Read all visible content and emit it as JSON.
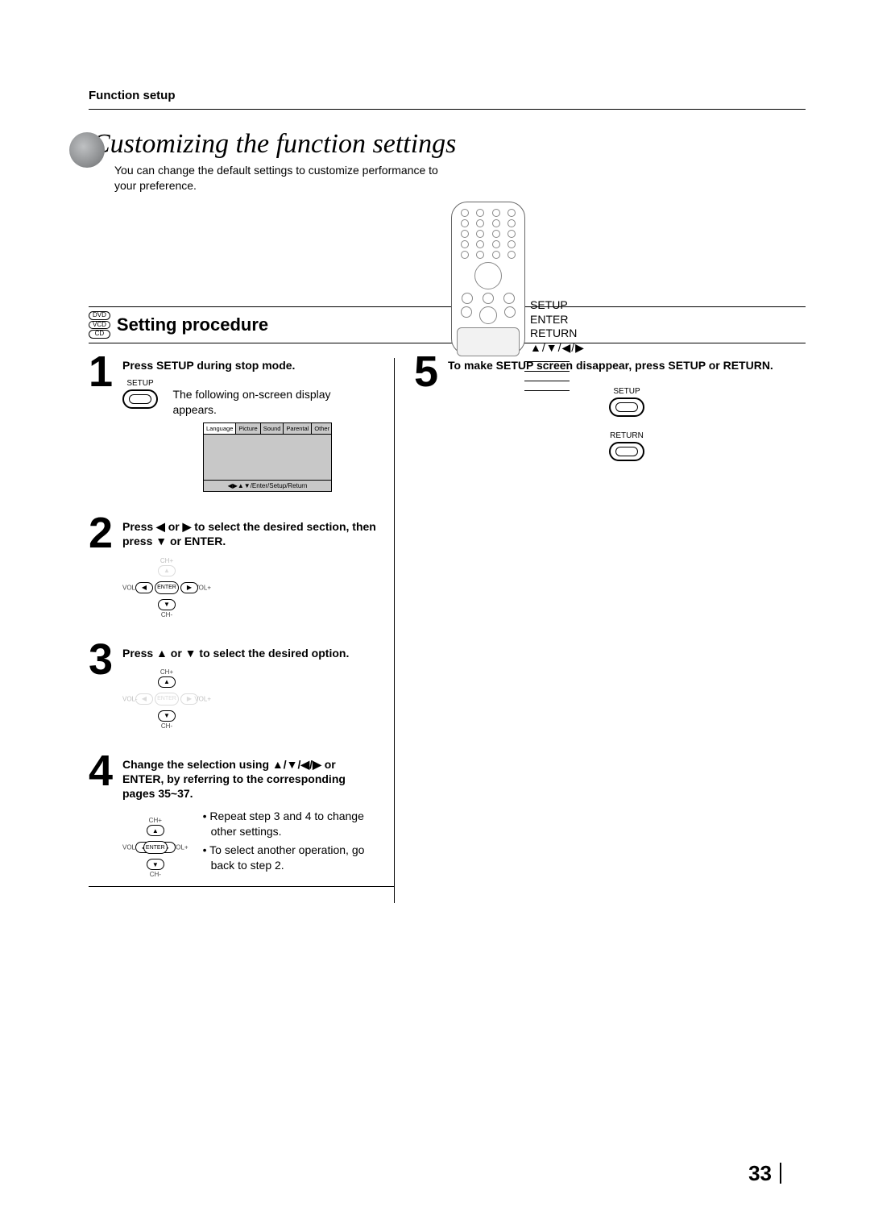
{
  "header": {
    "section": "Function setup"
  },
  "title": "Customizing the function settings",
  "intro": "You can change the default settings to customize performance to your preference.",
  "remote_labels": {
    "setup": "SETUP",
    "enter": "ENTER",
    "return": "RETURN",
    "arrows": "▲/▼/◀/▶"
  },
  "media_badges": [
    "DVD",
    "VCD",
    "CD"
  ],
  "section_heading": "Setting procedure",
  "steps": {
    "s1": {
      "num": "1",
      "title": "Press SETUP during stop mode.",
      "button": "SETUP",
      "text": "The following on-screen display appears."
    },
    "s2": {
      "num": "2",
      "title": "Press ◀ or ▶ to select the desired section, then press ▼ or ENTER."
    },
    "s3": {
      "num": "3",
      "title": "Press ▲ or ▼ to select the desired option."
    },
    "s4": {
      "num": "4",
      "title": "Change the selection using ▲/▼/◀/▶ or ENTER, by referring to the corresponding pages 35~37.",
      "b1": "• Repeat step 3 and 4 to change other settings.",
      "b2": "• To select another operation, go back to step 2."
    },
    "s5": {
      "num": "5",
      "title": "To make SETUP screen disappear, press SETUP or RETURN.",
      "btn1": "SETUP",
      "btn2": "RETURN"
    }
  },
  "osd": {
    "tabs": [
      "Language",
      "Picture",
      "Sound",
      "Parental",
      "Other"
    ],
    "footer": "◀▶▲▼/Enter/Setup/Return"
  },
  "dpad": {
    "up": "CH+",
    "down": "CH-",
    "left": "VOL-",
    "right": "VOL+",
    "enter": "ENTER"
  },
  "page_number": "33"
}
